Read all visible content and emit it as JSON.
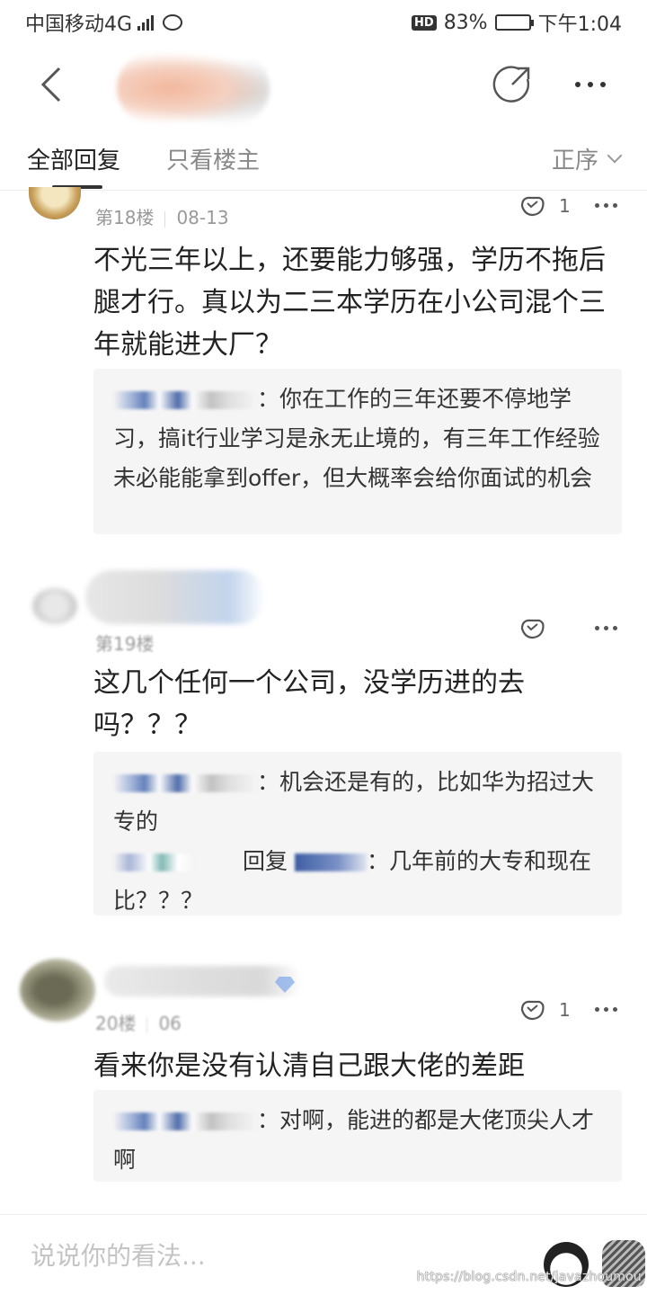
{
  "status_bar": {
    "carrier": "中国移动4G",
    "network_sup": "4G",
    "hd_badge": "HD",
    "battery": "83%",
    "battery_level": 0.83,
    "time": "下午1:04"
  },
  "tabs": {
    "all_replies": "全部回复",
    "op_only": "只看楼主",
    "sort": "正序"
  },
  "posts": [
    {
      "floor": "第18楼",
      "date": "08-13",
      "likes": "1",
      "body": "不光三年以上，还要能力够强，学历不拖后腿才行。真以为二三本学历在小公司混个三年就能进大厂？",
      "replies": [
        {
          "text": "：你在工作的三年还要不停地学习，搞it行业学习是永无止境的，有三年工作经验未必能能拿到offer，但大概率会给你面试的机会"
        }
      ]
    },
    {
      "floor": "第19楼",
      "date": "",
      "likes": "",
      "body": "这几个任何一个公司，没学历进的去吗？？？",
      "replies": [
        {
          "text": "：机会还是有的，比如华为招过大专的"
        },
        {
          "reply_word": "回复",
          "text": "：几年前的大专和现在比？？？"
        }
      ]
    },
    {
      "floor": "20楼",
      "date": "06",
      "likes": "1",
      "body": "看来你是没有认清自己跟大佬的差距",
      "replies": [
        {
          "text": "：对啊，能进的都是大佬顶尖人才啊"
        }
      ]
    }
  ],
  "comment_box": {
    "placeholder": "说说你的看法..."
  },
  "watermark": "https://blog.csdn.net/javazhoumou"
}
